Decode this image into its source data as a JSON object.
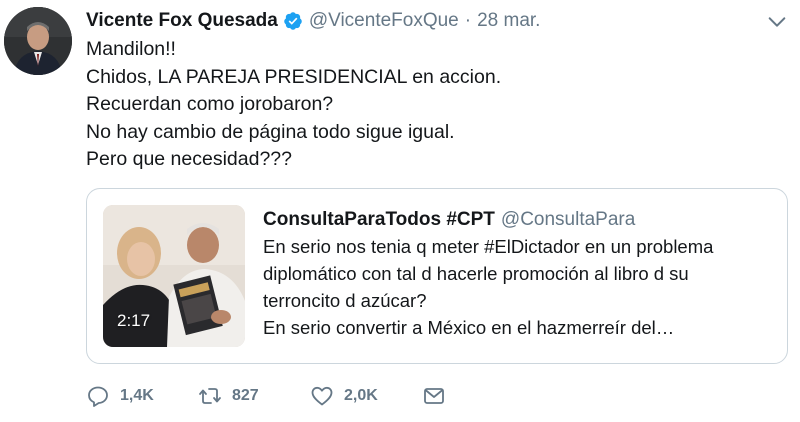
{
  "author": {
    "name": "Vicente Fox Quesada",
    "handle": "@VicenteFoxQue",
    "separator": "·",
    "date": "28 mar."
  },
  "tweet": {
    "lines": [
      "Mandilon!!",
      "Chidos, LA PAREJA PRESIDENCIAL en accion.",
      "Recuerdan como jorobaron?",
      "No hay cambio de página todo sigue igual.",
      "Pero que necesidad???"
    ]
  },
  "quoted": {
    "name": "ConsultaParaTodos #CPT",
    "handle": "@ConsultaPara",
    "media_duration": "2:17",
    "lines": [
      "En serio nos tenia q meter #ElDictador en un problema",
      "diplomático con tal d hacerle promoción al libro d su",
      "terroncito d azúcar?",
      "En serio convertir a México en el hazmerreír del…"
    ]
  },
  "actions": {
    "reply_count": "1,4K",
    "retweet_count": "827",
    "like_count": "2,0K"
  },
  "colors": {
    "text": "#14171a",
    "secondary": "#657786",
    "verified": "#1da1f2",
    "border": "#ccd6dd"
  },
  "icons": [
    "chevron-down-icon",
    "verified-badge-icon",
    "reply-icon",
    "retweet-icon",
    "like-icon",
    "message-icon"
  ]
}
